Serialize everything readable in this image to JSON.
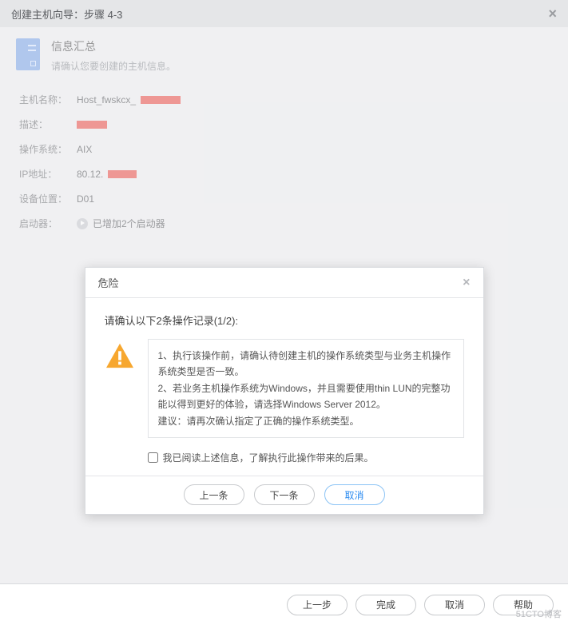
{
  "wizard": {
    "title": "创建主机向导：步骤 4-3",
    "section_title": "信息汇总",
    "section_sub": "请确认您要创建的主机信息。"
  },
  "summary": {
    "host_label": "主机名称：",
    "host_value": "Host_fwskcx_",
    "desc_label": "描述：",
    "os_label": "操作系统：",
    "os_value": "AIX",
    "ip_label": "IP地址：",
    "ip_value": "80.12.",
    "loc_label": "设备位置：",
    "loc_value": "D01",
    "init_label": "启动器：",
    "init_value": "已增加2个启动器"
  },
  "modal": {
    "title": "危险",
    "subtitle": "请确认以下2条操作记录(1/2):",
    "line1": "1、执行该操作前，请确认待创建主机的操作系统类型与业务主机操作系统类型是否一致。",
    "line2": "2、若业务主机操作系统为Windows，并且需要使用thin LUN的完整功能以得到更好的体验，请选择Windows Server 2012。",
    "line3": "建议：请再次确认指定了正确的操作系统类型。",
    "ack": "我已阅读上述信息，了解执行此操作带来的后果。",
    "prev": "上一条",
    "next": "下一条",
    "cancel": "取消"
  },
  "footer": {
    "prev": "上一步",
    "finish": "完成",
    "cancel": "取消",
    "help": "帮助"
  },
  "watermark": "51CTO博客"
}
